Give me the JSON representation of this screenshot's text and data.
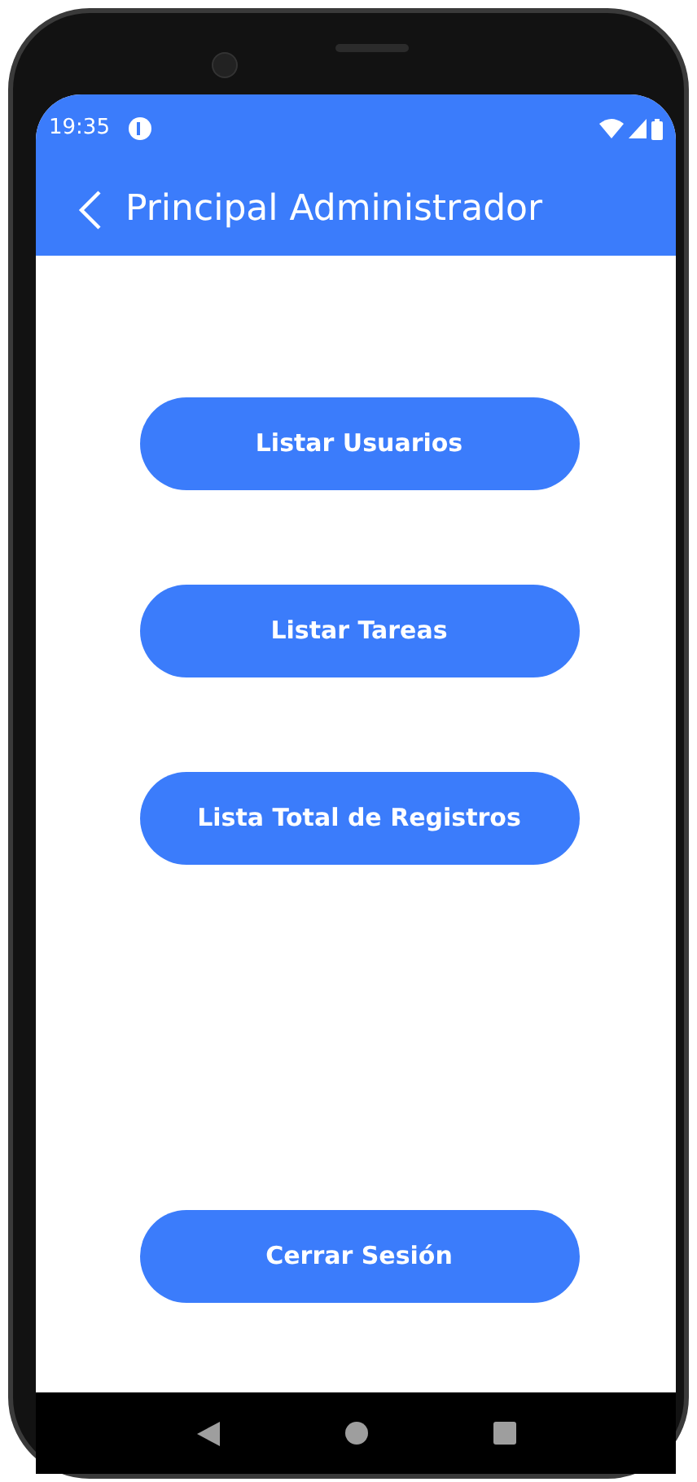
{
  "status_bar": {
    "time": "19:35"
  },
  "app_bar": {
    "title": "Principal Administrador"
  },
  "buttons": [
    {
      "label": "Listar Usuarios",
      "kind": "menu"
    },
    {
      "label": "Listar Tareas",
      "kind": "menu"
    },
    {
      "label": "Lista Total de Registros",
      "kind": "menu"
    },
    {
      "label": "Cerrar Sesión",
      "kind": "logout"
    }
  ]
}
